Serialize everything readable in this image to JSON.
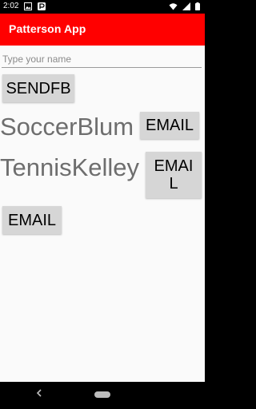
{
  "status_bar": {
    "time": "2:02",
    "icons": [
      "image-icon",
      "p-app-icon",
      "wifi-icon",
      "signal-icon",
      "battery-icon"
    ]
  },
  "app_bar": {
    "title": "Patterson App",
    "color": "#ff0000"
  },
  "form": {
    "name_placeholder": "Type your name",
    "name_value": ""
  },
  "buttons": {
    "sendfb": "SENDFB",
    "email": "EMAIL"
  },
  "rows": [
    {
      "label": "SoccerBlum",
      "button": "EMAIL"
    },
    {
      "label": "TennisKelley",
      "button": "EMAIL"
    }
  ],
  "bottom_button": "EMAIL",
  "nav": {
    "icons": [
      "back-icon",
      "home-pill-icon"
    ]
  }
}
